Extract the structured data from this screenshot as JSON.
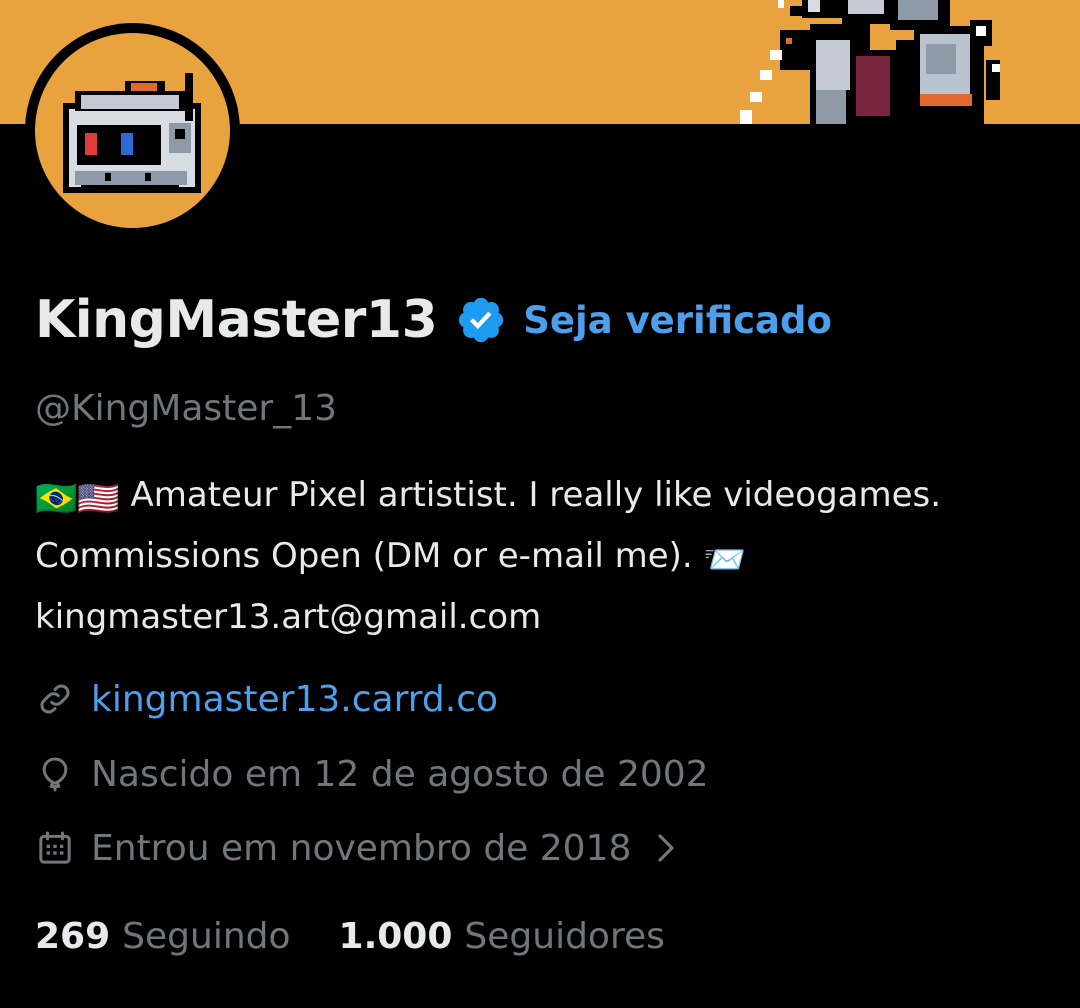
{
  "colors": {
    "banner": "#e8a23e",
    "accent": "#4d9fec",
    "text_primary": "#e7e9ea",
    "text_secondary": "#71767b",
    "background": "#000000"
  },
  "profile": {
    "display_name": "KingMaster13",
    "verified_icon": "verified-badge-icon",
    "get_verified_label": "Seja verificado",
    "handle": "@KingMaster_13",
    "bio": {
      "line1_emojis": "🇧🇷🇺🇸",
      "line1_text": "Amateur Pixel artistist. I really like videogames.",
      "line2_text": "Commissions Open (DM or e-mail me).",
      "line2_emoji": "📨",
      "line3_text": "kingmaster13.art@gmail.com"
    },
    "website": {
      "icon": "link-icon",
      "text": "kingmaster13.carrd.co"
    },
    "birthday": {
      "icon": "balloon-icon",
      "text": "Nascido em 12 de agosto de 2002"
    },
    "joined": {
      "icon": "calendar-icon",
      "text": "Entrou em novembro de 2018",
      "chevron_icon": "chevron-right-icon"
    },
    "stats": {
      "following_count": "269",
      "following_label": "Seguindo",
      "followers_count": "1.000",
      "followers_label": "Seguidores"
    }
  }
}
